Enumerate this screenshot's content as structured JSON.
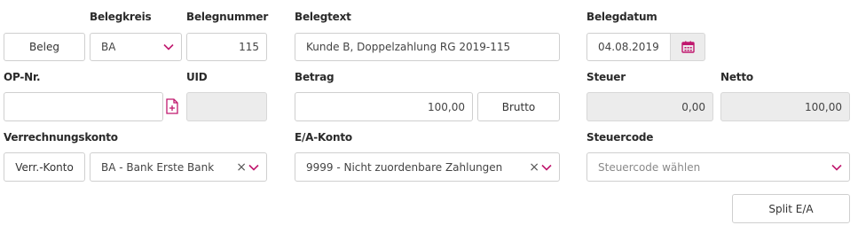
{
  "labels": {
    "belegkreis": "Belegkreis",
    "belegnummer": "Belegnummer",
    "belegtext": "Belegtext",
    "belegdatum": "Belegdatum",
    "op_nr": "OP-Nr.",
    "uid": "UID",
    "betrag": "Betrag",
    "steuer": "Steuer",
    "netto": "Netto",
    "verrechnungskonto": "Verrechnungskonto",
    "ea_konto": "E/A-Konto",
    "steuercode": "Steuercode"
  },
  "buttons": {
    "beleg": "Beleg",
    "brutto": "Brutto",
    "verr_konto": "Verr.-Konto",
    "split_ea": "Split E/A"
  },
  "fields": {
    "belegkreis_value": "BA",
    "belegnummer_value": "115",
    "belegtext_value": "Kunde B, Doppelzahlung RG 2019-115",
    "belegdatum_value": "04.08.2019",
    "op_nr_value": "",
    "uid_value": "",
    "betrag_value": "100,00",
    "steuer_value": "0,00",
    "netto_value": "100,00",
    "verrechnungskonto_value": "BA - Bank Erste Bank",
    "ea_konto_value": "9999 - Nicht zuordenbare Zahlungen",
    "steuercode_placeholder": "Steuercode wählen"
  },
  "glyphs": {
    "clear": "×"
  },
  "icons": {
    "calendar": "calendar-icon",
    "chevron": "chevron-down-icon",
    "add_document": "add-document-icon"
  },
  "colors": {
    "accent": "#c0186e",
    "border": "#cfcfcf",
    "readonly_bg": "#ececec"
  }
}
